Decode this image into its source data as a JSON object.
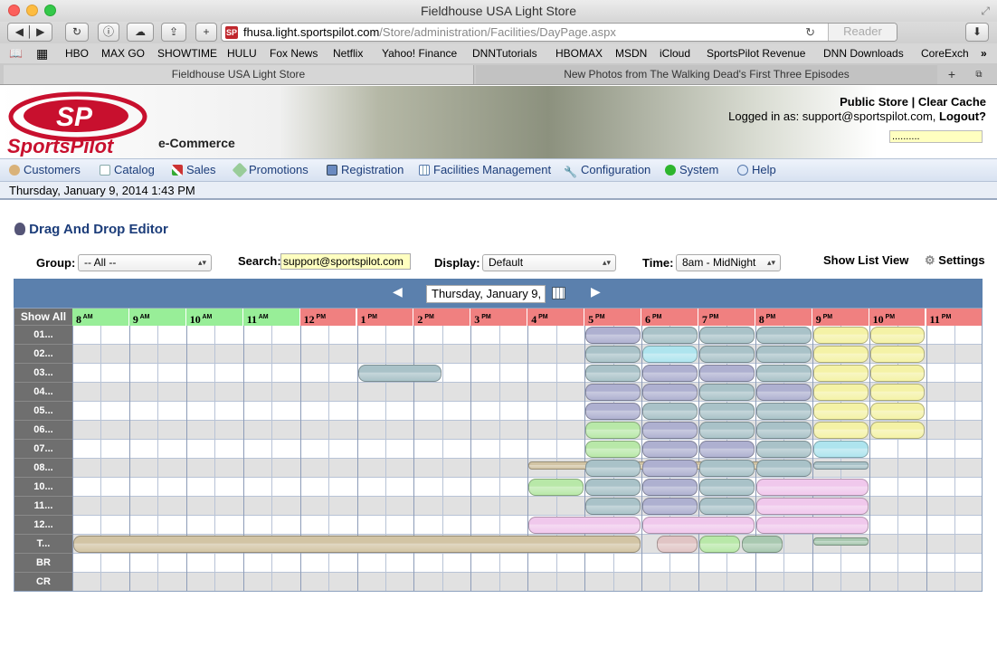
{
  "window_title": "Fieldhouse USA Light Store",
  "browser": {
    "url_host": "fhusa.light.sportspilot.com",
    "url_path": "/Store/administration/Facilities/DayPage.aspx",
    "reader_label": "Reader",
    "bookmarks": [
      "HBO",
      "MAX GO",
      "SHOWTIME",
      "HULU",
      "Fox News",
      "Netflix",
      "Yahoo! Finance",
      "DNNTutorials",
      "HBOMAX",
      "MSDN",
      "iCloud",
      "SportsPilot Revenue",
      "DNN Downloads",
      "CoreExch"
    ],
    "tabs": [
      "Fieldhouse USA Light Store",
      "New Photos from The Walking Dead's First Three Episodes"
    ]
  },
  "header": {
    "logo_text": "SportsPilot",
    "ecommerce_label": "e-Commerce",
    "public_store": "Public Store",
    "separator": "|",
    "clear_cache": "Clear Cache",
    "logged_in_text": "Logged in as: support@sportspilot.com,",
    "logout": "Logout?",
    "password_mask": ".........."
  },
  "nav": {
    "items": [
      {
        "label": "Customers",
        "icon": "person-icon"
      },
      {
        "label": "Catalog",
        "icon": "catalog-icon"
      },
      {
        "label": "Sales",
        "icon": "chart-icon"
      },
      {
        "label": "Promotions",
        "icon": "tag-icon"
      },
      {
        "label": "Registration",
        "icon": "registration-icon"
      },
      {
        "label": "Facilities Management",
        "icon": "facility-grid-icon"
      },
      {
        "label": "Configuration",
        "icon": "wrench-icon"
      },
      {
        "label": "System",
        "icon": "green-dot-icon"
      },
      {
        "label": "Help",
        "icon": "help-icon"
      }
    ]
  },
  "current_datetime": "Thursday, January 9, 2014 1:43 PM",
  "editor": {
    "title": "Drag And Drop Editor",
    "group_label": "Group:",
    "group_value": "-- All --",
    "search_label": "Search:",
    "search_value": "support@sportspilot.com",
    "display_label": "Display:",
    "display_value": "Default",
    "time_label": "Time:",
    "time_value": "8am - MidNight",
    "show_list_view": "Show List View",
    "settings": "Settings",
    "date_value": "Thursday, January 9, 2014",
    "prev_arrow": "◀",
    "next_arrow": "▶"
  },
  "schedule": {
    "show_all": "Show All",
    "hours": [
      {
        "h": "8",
        "ap": "AM"
      },
      {
        "h": "9",
        "ap": "AM"
      },
      {
        "h": "10",
        "ap": "AM"
      },
      {
        "h": "11",
        "ap": "AM"
      },
      {
        "h": "12",
        "ap": "PM"
      },
      {
        "h": "1",
        "ap": "PM"
      },
      {
        "h": "2",
        "ap": "PM"
      },
      {
        "h": "3",
        "ap": "PM"
      },
      {
        "h": "4",
        "ap": "PM"
      },
      {
        "h": "5",
        "ap": "PM"
      },
      {
        "h": "6",
        "ap": "PM"
      },
      {
        "h": "7",
        "ap": "PM"
      },
      {
        "h": "8",
        "ap": "PM"
      },
      {
        "h": "9",
        "ap": "PM"
      },
      {
        "h": "10",
        "ap": "PM"
      },
      {
        "h": "11",
        "ap": "PM"
      }
    ],
    "am_color": "#98ee98",
    "pm_color": "#f08080",
    "rows": [
      "01...",
      "02...",
      "03...",
      "04...",
      "05...",
      "06...",
      "07...",
      "08...",
      "10...",
      "11...",
      "12...",
      "T...",
      "BR",
      "CR"
    ],
    "colors": {
      "steel": "#a9c2c8",
      "lavender": "#aeb0d0",
      "yellow": "#f4f2a6",
      "green": "#b8e8a8",
      "cyan": "#aee4ee",
      "pink": "#f0c8ec",
      "tan": "#d2c4a4",
      "rose": "#e0c4c4",
      "sage": "#a8c8b0"
    },
    "events": [
      {
        "row": 0,
        "start": 17.0,
        "end": 18.0,
        "color": "lavender"
      },
      {
        "row": 0,
        "start": 18.0,
        "end": 19.0,
        "color": "steel"
      },
      {
        "row": 0,
        "start": 19.0,
        "end": 20.0,
        "color": "steel"
      },
      {
        "row": 0,
        "start": 20.0,
        "end": 21.0,
        "color": "steel"
      },
      {
        "row": 0,
        "start": 21.0,
        "end": 22.0,
        "color": "yellow"
      },
      {
        "row": 0,
        "start": 22.0,
        "end": 23.0,
        "color": "yellow"
      },
      {
        "row": 1,
        "start": 17.0,
        "end": 18.0,
        "color": "steel"
      },
      {
        "row": 1,
        "start": 18.0,
        "end": 19.0,
        "color": "cyan"
      },
      {
        "row": 1,
        "start": 19.0,
        "end": 20.0,
        "color": "steel"
      },
      {
        "row": 1,
        "start": 20.0,
        "end": 21.0,
        "color": "steel"
      },
      {
        "row": 1,
        "start": 21.0,
        "end": 22.0,
        "color": "yellow"
      },
      {
        "row": 1,
        "start": 22.0,
        "end": 23.0,
        "color": "yellow"
      },
      {
        "row": 2,
        "start": 13.0,
        "end": 14.5,
        "color": "steel"
      },
      {
        "row": 2,
        "start": 17.0,
        "end": 18.0,
        "color": "steel"
      },
      {
        "row": 2,
        "start": 18.0,
        "end": 19.0,
        "color": "lavender"
      },
      {
        "row": 2,
        "start": 19.0,
        "end": 20.0,
        "color": "lavender"
      },
      {
        "row": 2,
        "start": 20.0,
        "end": 21.0,
        "color": "steel"
      },
      {
        "row": 2,
        "start": 21.0,
        "end": 22.0,
        "color": "yellow"
      },
      {
        "row": 2,
        "start": 22.0,
        "end": 23.0,
        "color": "yellow"
      },
      {
        "row": 3,
        "start": 17.0,
        "end": 18.0,
        "color": "lavender"
      },
      {
        "row": 3,
        "start": 18.0,
        "end": 19.0,
        "color": "lavender"
      },
      {
        "row": 3,
        "start": 19.0,
        "end": 20.0,
        "color": "steel"
      },
      {
        "row": 3,
        "start": 20.0,
        "end": 21.0,
        "color": "lavender"
      },
      {
        "row": 3,
        "start": 21.0,
        "end": 22.0,
        "color": "yellow"
      },
      {
        "row": 3,
        "start": 22.0,
        "end": 23.0,
        "color": "yellow"
      },
      {
        "row": 4,
        "start": 17.0,
        "end": 18.0,
        "color": "lavender"
      },
      {
        "row": 4,
        "start": 18.0,
        "end": 19.0,
        "color": "steel"
      },
      {
        "row": 4,
        "start": 19.0,
        "end": 20.0,
        "color": "steel"
      },
      {
        "row": 4,
        "start": 20.0,
        "end": 21.0,
        "color": "steel"
      },
      {
        "row": 4,
        "start": 21.0,
        "end": 22.0,
        "color": "yellow"
      },
      {
        "row": 4,
        "start": 22.0,
        "end": 23.0,
        "color": "yellow"
      },
      {
        "row": 5,
        "start": 17.0,
        "end": 18.0,
        "color": "green"
      },
      {
        "row": 5,
        "start": 18.0,
        "end": 19.0,
        "color": "lavender"
      },
      {
        "row": 5,
        "start": 19.0,
        "end": 20.0,
        "color": "steel"
      },
      {
        "row": 5,
        "start": 20.0,
        "end": 21.0,
        "color": "steel"
      },
      {
        "row": 5,
        "start": 21.0,
        "end": 22.0,
        "color": "yellow"
      },
      {
        "row": 5,
        "start": 22.0,
        "end": 23.0,
        "color": "yellow"
      },
      {
        "row": 6,
        "start": 17.0,
        "end": 18.0,
        "color": "green"
      },
      {
        "row": 6,
        "start": 18.0,
        "end": 19.0,
        "color": "lavender"
      },
      {
        "row": 6,
        "start": 19.0,
        "end": 20.0,
        "color": "lavender"
      },
      {
        "row": 6,
        "start": 20.0,
        "end": 21.0,
        "color": "steel"
      },
      {
        "row": 6,
        "start": 21.0,
        "end": 22.0,
        "color": "cyan"
      },
      {
        "row": 7,
        "start": 16.0,
        "end": 21.0,
        "color": "tan",
        "thin": true
      },
      {
        "row": 7,
        "start": 17.0,
        "end": 18.0,
        "color": "steel"
      },
      {
        "row": 7,
        "start": 18.0,
        "end": 19.0,
        "color": "lavender"
      },
      {
        "row": 7,
        "start": 19.0,
        "end": 20.0,
        "color": "steel"
      },
      {
        "row": 7,
        "start": 20.0,
        "end": 21.0,
        "color": "steel"
      },
      {
        "row": 7,
        "start": 21.0,
        "end": 22.0,
        "color": "steel",
        "thin": true
      },
      {
        "row": 8,
        "start": 16.0,
        "end": 17.0,
        "color": "green"
      },
      {
        "row": 8,
        "start": 17.0,
        "end": 18.0,
        "color": "steel"
      },
      {
        "row": 8,
        "start": 18.0,
        "end": 19.0,
        "color": "lavender"
      },
      {
        "row": 8,
        "start": 19.0,
        "end": 20.0,
        "color": "steel"
      },
      {
        "row": 8,
        "start": 20.0,
        "end": 22.0,
        "color": "pink"
      },
      {
        "row": 9,
        "start": 17.0,
        "end": 18.0,
        "color": "steel"
      },
      {
        "row": 9,
        "start": 18.0,
        "end": 19.0,
        "color": "lavender"
      },
      {
        "row": 9,
        "start": 19.0,
        "end": 20.0,
        "color": "steel"
      },
      {
        "row": 9,
        "start": 20.0,
        "end": 22.0,
        "color": "pink"
      },
      {
        "row": 10,
        "start": 16.0,
        "end": 18.0,
        "color": "pink"
      },
      {
        "row": 10,
        "start": 18.0,
        "end": 20.0,
        "color": "pink"
      },
      {
        "row": 10,
        "start": 20.0,
        "end": 22.0,
        "color": "pink"
      },
      {
        "row": 11,
        "start": 8.0,
        "end": 18.0,
        "color": "tan"
      },
      {
        "row": 11,
        "start": 18.25,
        "end": 19.0,
        "color": "rose"
      },
      {
        "row": 11,
        "start": 19.0,
        "end": 19.75,
        "color": "green"
      },
      {
        "row": 11,
        "start": 19.75,
        "end": 20.5,
        "color": "sage"
      },
      {
        "row": 11,
        "start": 21.0,
        "end": 22.0,
        "color": "sage",
        "thin": true
      }
    ]
  }
}
